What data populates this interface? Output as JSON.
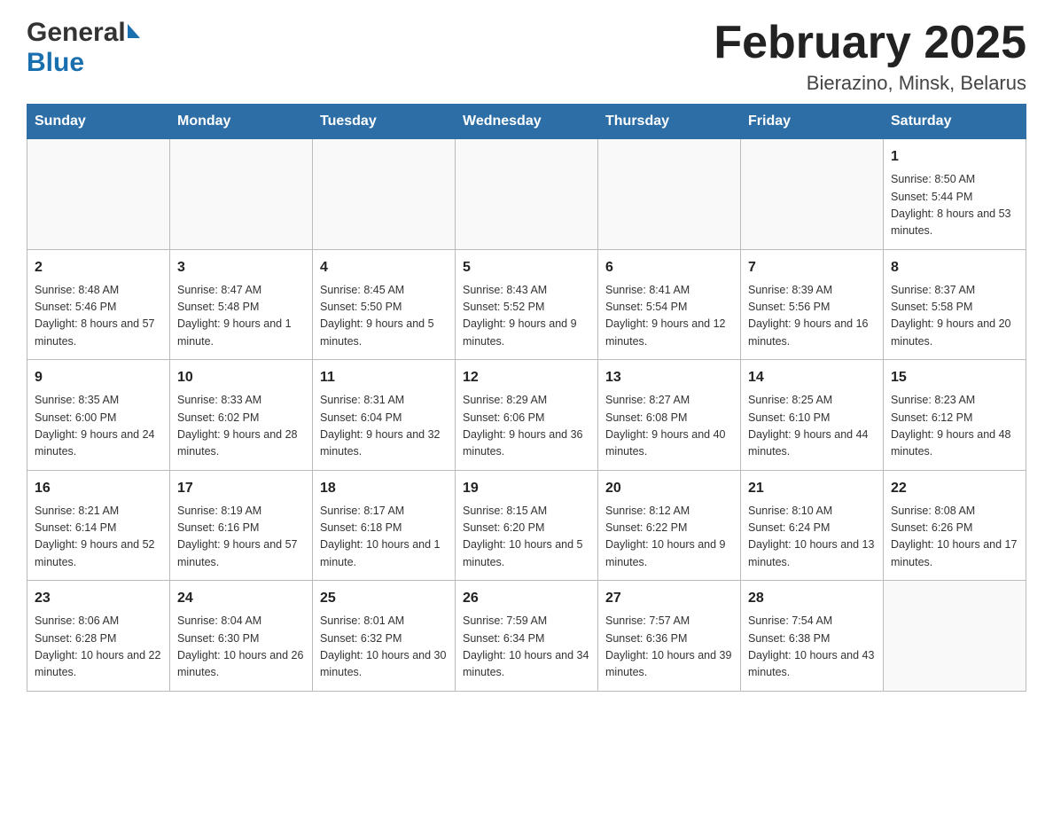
{
  "header": {
    "title": "February 2025",
    "subtitle": "Bierazino, Minsk, Belarus",
    "logo_general": "General",
    "logo_blue": "Blue"
  },
  "days_of_week": [
    "Sunday",
    "Monday",
    "Tuesday",
    "Wednesday",
    "Thursday",
    "Friday",
    "Saturday"
  ],
  "weeks": [
    [
      {
        "day": "",
        "info": ""
      },
      {
        "day": "",
        "info": ""
      },
      {
        "day": "",
        "info": ""
      },
      {
        "day": "",
        "info": ""
      },
      {
        "day": "",
        "info": ""
      },
      {
        "day": "",
        "info": ""
      },
      {
        "day": "1",
        "info": "Sunrise: 8:50 AM\nSunset: 5:44 PM\nDaylight: 8 hours and 53 minutes."
      }
    ],
    [
      {
        "day": "2",
        "info": "Sunrise: 8:48 AM\nSunset: 5:46 PM\nDaylight: 8 hours and 57 minutes."
      },
      {
        "day": "3",
        "info": "Sunrise: 8:47 AM\nSunset: 5:48 PM\nDaylight: 9 hours and 1 minute."
      },
      {
        "day": "4",
        "info": "Sunrise: 8:45 AM\nSunset: 5:50 PM\nDaylight: 9 hours and 5 minutes."
      },
      {
        "day": "5",
        "info": "Sunrise: 8:43 AM\nSunset: 5:52 PM\nDaylight: 9 hours and 9 minutes."
      },
      {
        "day": "6",
        "info": "Sunrise: 8:41 AM\nSunset: 5:54 PM\nDaylight: 9 hours and 12 minutes."
      },
      {
        "day": "7",
        "info": "Sunrise: 8:39 AM\nSunset: 5:56 PM\nDaylight: 9 hours and 16 minutes."
      },
      {
        "day": "8",
        "info": "Sunrise: 8:37 AM\nSunset: 5:58 PM\nDaylight: 9 hours and 20 minutes."
      }
    ],
    [
      {
        "day": "9",
        "info": "Sunrise: 8:35 AM\nSunset: 6:00 PM\nDaylight: 9 hours and 24 minutes."
      },
      {
        "day": "10",
        "info": "Sunrise: 8:33 AM\nSunset: 6:02 PM\nDaylight: 9 hours and 28 minutes."
      },
      {
        "day": "11",
        "info": "Sunrise: 8:31 AM\nSunset: 6:04 PM\nDaylight: 9 hours and 32 minutes."
      },
      {
        "day": "12",
        "info": "Sunrise: 8:29 AM\nSunset: 6:06 PM\nDaylight: 9 hours and 36 minutes."
      },
      {
        "day": "13",
        "info": "Sunrise: 8:27 AM\nSunset: 6:08 PM\nDaylight: 9 hours and 40 minutes."
      },
      {
        "day": "14",
        "info": "Sunrise: 8:25 AM\nSunset: 6:10 PM\nDaylight: 9 hours and 44 minutes."
      },
      {
        "day": "15",
        "info": "Sunrise: 8:23 AM\nSunset: 6:12 PM\nDaylight: 9 hours and 48 minutes."
      }
    ],
    [
      {
        "day": "16",
        "info": "Sunrise: 8:21 AM\nSunset: 6:14 PM\nDaylight: 9 hours and 52 minutes."
      },
      {
        "day": "17",
        "info": "Sunrise: 8:19 AM\nSunset: 6:16 PM\nDaylight: 9 hours and 57 minutes."
      },
      {
        "day": "18",
        "info": "Sunrise: 8:17 AM\nSunset: 6:18 PM\nDaylight: 10 hours and 1 minute."
      },
      {
        "day": "19",
        "info": "Sunrise: 8:15 AM\nSunset: 6:20 PM\nDaylight: 10 hours and 5 minutes."
      },
      {
        "day": "20",
        "info": "Sunrise: 8:12 AM\nSunset: 6:22 PM\nDaylight: 10 hours and 9 minutes."
      },
      {
        "day": "21",
        "info": "Sunrise: 8:10 AM\nSunset: 6:24 PM\nDaylight: 10 hours and 13 minutes."
      },
      {
        "day": "22",
        "info": "Sunrise: 8:08 AM\nSunset: 6:26 PM\nDaylight: 10 hours and 17 minutes."
      }
    ],
    [
      {
        "day": "23",
        "info": "Sunrise: 8:06 AM\nSunset: 6:28 PM\nDaylight: 10 hours and 22 minutes."
      },
      {
        "day": "24",
        "info": "Sunrise: 8:04 AM\nSunset: 6:30 PM\nDaylight: 10 hours and 26 minutes."
      },
      {
        "day": "25",
        "info": "Sunrise: 8:01 AM\nSunset: 6:32 PM\nDaylight: 10 hours and 30 minutes."
      },
      {
        "day": "26",
        "info": "Sunrise: 7:59 AM\nSunset: 6:34 PM\nDaylight: 10 hours and 34 minutes."
      },
      {
        "day": "27",
        "info": "Sunrise: 7:57 AM\nSunset: 6:36 PM\nDaylight: 10 hours and 39 minutes."
      },
      {
        "day": "28",
        "info": "Sunrise: 7:54 AM\nSunset: 6:38 PM\nDaylight: 10 hours and 43 minutes."
      },
      {
        "day": "",
        "info": ""
      }
    ]
  ]
}
